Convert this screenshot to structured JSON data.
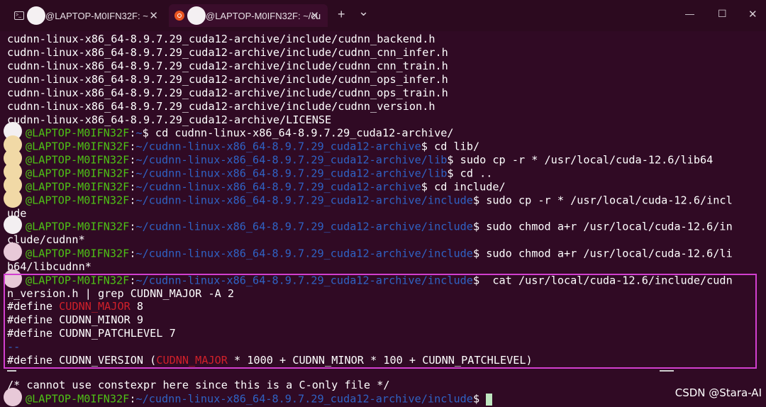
{
  "tabs": [
    {
      "title": "@LAPTOP-M0IFN32F: ~",
      "close": "✕"
    },
    {
      "title": "@LAPTOP-M0IFN32F: ~/cu",
      "close": "✕"
    }
  ],
  "tabbar": {
    "new_tab": "+",
    "dropdown": "⌄",
    "minimize": "—",
    "maximize": "☐",
    "close": "✕"
  },
  "terminal": {
    "output": [
      "cudnn-linux-x86_64-8.9.7.29_cuda12-archive/include/cudnn_backend.h",
      "cudnn-linux-x86_64-8.9.7.29_cuda12-archive/include/cudnn_cnn_infer.h",
      "cudnn-linux-x86_64-8.9.7.29_cuda12-archive/include/cudnn_cnn_train.h",
      "cudnn-linux-x86_64-8.9.7.29_cuda12-archive/include/cudnn_ops_infer.h",
      "cudnn-linux-x86_64-8.9.7.29_cuda12-archive/include/cudnn_ops_train.h",
      "cudnn-linux-x86_64-8.9.7.29_cuda12-archive/include/cudnn_version.h",
      "cudnn-linux-x86_64-8.9.7.29_cuda12-archive/LICENSE"
    ],
    "host": "@LAPTOP-M0IFN32F",
    "paths": {
      "home": "~",
      "archive": "~/cudnn-linux-x86_64-8.9.7.29_cuda12-archive",
      "lib": "~/cudnn-linux-x86_64-8.9.7.29_cuda12-archive/lib",
      "include": "~/cudnn-linux-x86_64-8.9.7.29_cuda12-archive/include"
    },
    "commands": {
      "c1": " cd cudnn-linux-x86_64-8.9.7.29_cuda12-archive/",
      "c2": " cd lib/",
      "c3": " sudo cp -r * /usr/local/cuda-12.6/lib64",
      "c4": " cd ..",
      "c5": " cd include/",
      "c6a": " sudo cp -r * /usr/local/cuda-12.6/incl",
      "c6b": "ude",
      "c7a": " sudo chmod a+r /usr/local/cuda-12.6/in",
      "c7b": "clude/cudnn*",
      "c8a": " sudo chmod a+r /usr/local/cuda-12.6/li",
      "c8b": "b64/libcudnn*",
      "c9a": "  cat /usr/local/cuda-12.6/include/cudn",
      "c9b": "n_version.h | grep CUDNN_MAJOR -A 2"
    },
    "grep": {
      "define": "#define ",
      "major_name": "CUDNN_MAJOR",
      "major_val": " 8",
      "minor": "#define CUDNN_MINOR 9",
      "patch": "#define CUDNN_PATCHLEVEL 7",
      "sep": "--",
      "version_a": "#define CUDNN_VERSION (",
      "version_b": " * 1000 + CUDNN_MINOR * 100 + CUDNN_PATCHLEVEL)"
    },
    "comment": "/* cannot use constexpr here since this is a C-only file */",
    "colors": {
      "background": "#300a24",
      "prompt_host": "#4ec016",
      "prompt_path": "#2f62c4",
      "highlight_box": "#d23fcf",
      "grep_match": "#d0202a"
    }
  },
  "watermark": "CSDN @Stara-AI"
}
